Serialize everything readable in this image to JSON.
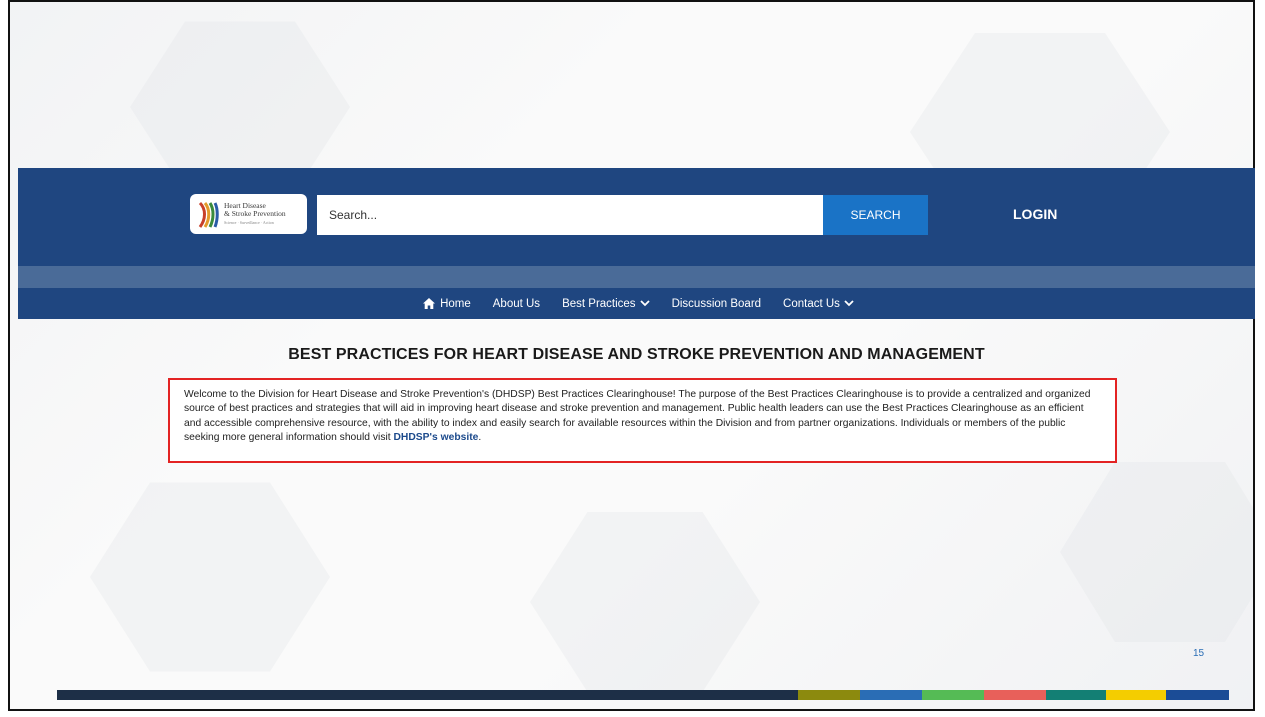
{
  "logo": {
    "line1": "Heart Disease",
    "line2": "& Stroke Prevention",
    "tagline": "Science · Surveillance · Action"
  },
  "search": {
    "placeholder": "Search...",
    "button_label": "SEARCH"
  },
  "header": {
    "login_label": "LOGIN"
  },
  "nav": {
    "items": [
      {
        "label": "Home",
        "icon": "home-icon"
      },
      {
        "label": "About Us"
      },
      {
        "label": "Best Practices",
        "icon": "chevron-down-icon"
      },
      {
        "label": "Discussion Board"
      },
      {
        "label": "Contact Us",
        "icon": "chevron-down-icon"
      }
    ]
  },
  "main": {
    "title": "BEST PRACTICES FOR HEART DISEASE AND STROKE PREVENTION AND MANAGEMENT",
    "intro_text": "Welcome to the Division for Heart Disease and Stroke Prevention's (DHDSP) Best Practices Clearinghouse! The purpose of the Best Practices Clearinghouse is to provide a centralized and organized source of best practices and strategies that will aid in improving heart disease and stroke prevention and management. Public health leaders can use the Best Practices Clearinghouse as an efficient and accessible comprehensive resource, with the ability to index and easily search for available resources within the Division and from partner organizations. Individuals or members of the public seeking more general information should visit",
    "link_text": "DHDSP's website",
    "trailing": "."
  },
  "slide": {
    "page_number": "15",
    "footer_colors": [
      "#1d2f47",
      "#8c8a0e",
      "#2a6db5",
      "#55bb55",
      "#e8605a",
      "#137f74",
      "#f4cd00",
      "#1b4c96"
    ]
  },
  "colors": {
    "header_bg": "#1f4680",
    "search_button": "#1a73c6",
    "highlight_border": "#e32323",
    "link": "#1c4a8c"
  }
}
